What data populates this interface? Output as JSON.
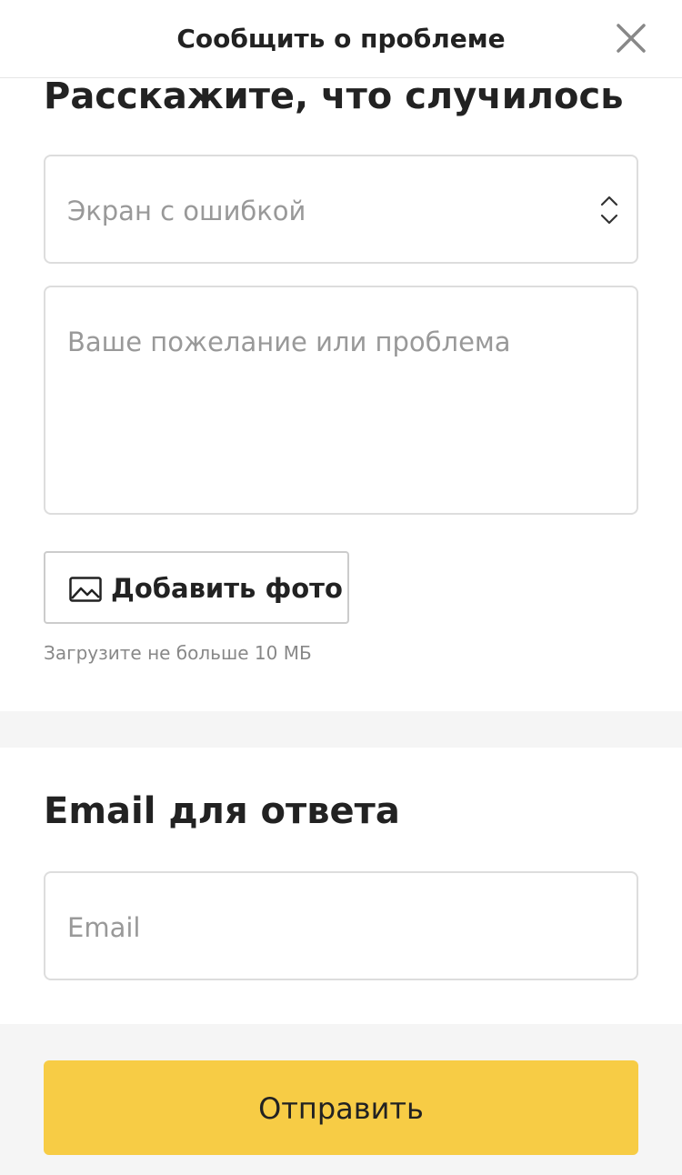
{
  "header": {
    "title": "Сообщить о проблеме",
    "close_icon": "close-icon"
  },
  "problem_section": {
    "title": "Расскажите, что случилось",
    "screen_select": {
      "placeholder": "Экран с ошибкой",
      "icon": "chevron-up-down-icon"
    },
    "description": {
      "placeholder": "Ваше пожелание или проблема"
    },
    "add_photo": {
      "label": "Добавить фото",
      "icon": "image-icon"
    },
    "upload_hint": "Загрузите не больше 10 МБ"
  },
  "email_section": {
    "title": "Email для ответа",
    "email_input": {
      "placeholder": "Email"
    }
  },
  "footer": {
    "submit_label": "Отправить"
  },
  "colors": {
    "accent": "#f7cc45",
    "border": "#dddddd",
    "placeholder": "#999999",
    "band": "#f5f5f5"
  }
}
